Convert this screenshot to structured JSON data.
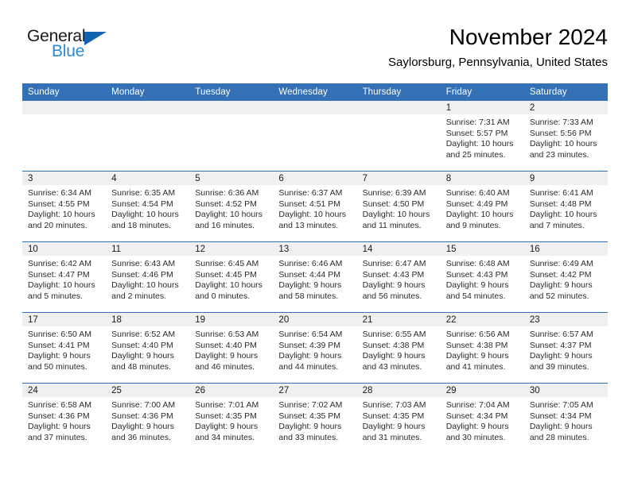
{
  "brand": {
    "name_dark": "General",
    "name_blue": "Blue",
    "triangle_color": "#1163ad",
    "blue_color": "#2a8ad4"
  },
  "header": {
    "title": "November 2024",
    "location": "Saylorsburg, Pennsylvania, United States"
  },
  "theme": {
    "header_blue": "#3370b5",
    "daynum_band": "#f0f0f0",
    "page_background": "#ffffff"
  },
  "weekdays": [
    "Sunday",
    "Monday",
    "Tuesday",
    "Wednesday",
    "Thursday",
    "Friday",
    "Saturday"
  ],
  "weeks": [
    [
      {
        "day": "",
        "empty": true
      },
      {
        "day": "",
        "empty": true
      },
      {
        "day": "",
        "empty": true
      },
      {
        "day": "",
        "empty": true
      },
      {
        "day": "",
        "empty": true
      },
      {
        "day": "1",
        "sunrise": "Sunrise: 7:31 AM",
        "sunset": "Sunset: 5:57 PM",
        "daylight": "Daylight: 10 hours and 25 minutes."
      },
      {
        "day": "2",
        "sunrise": "Sunrise: 7:33 AM",
        "sunset": "Sunset: 5:56 PM",
        "daylight": "Daylight: 10 hours and 23 minutes."
      }
    ],
    [
      {
        "day": "3",
        "sunrise": "Sunrise: 6:34 AM",
        "sunset": "Sunset: 4:55 PM",
        "daylight": "Daylight: 10 hours and 20 minutes."
      },
      {
        "day": "4",
        "sunrise": "Sunrise: 6:35 AM",
        "sunset": "Sunset: 4:54 PM",
        "daylight": "Daylight: 10 hours and 18 minutes."
      },
      {
        "day": "5",
        "sunrise": "Sunrise: 6:36 AM",
        "sunset": "Sunset: 4:52 PM",
        "daylight": "Daylight: 10 hours and 16 minutes."
      },
      {
        "day": "6",
        "sunrise": "Sunrise: 6:37 AM",
        "sunset": "Sunset: 4:51 PM",
        "daylight": "Daylight: 10 hours and 13 minutes."
      },
      {
        "day": "7",
        "sunrise": "Sunrise: 6:39 AM",
        "sunset": "Sunset: 4:50 PM",
        "daylight": "Daylight: 10 hours and 11 minutes."
      },
      {
        "day": "8",
        "sunrise": "Sunrise: 6:40 AM",
        "sunset": "Sunset: 4:49 PM",
        "daylight": "Daylight: 10 hours and 9 minutes."
      },
      {
        "day": "9",
        "sunrise": "Sunrise: 6:41 AM",
        "sunset": "Sunset: 4:48 PM",
        "daylight": "Daylight: 10 hours and 7 minutes."
      }
    ],
    [
      {
        "day": "10",
        "sunrise": "Sunrise: 6:42 AM",
        "sunset": "Sunset: 4:47 PM",
        "daylight": "Daylight: 10 hours and 5 minutes."
      },
      {
        "day": "11",
        "sunrise": "Sunrise: 6:43 AM",
        "sunset": "Sunset: 4:46 PM",
        "daylight": "Daylight: 10 hours and 2 minutes."
      },
      {
        "day": "12",
        "sunrise": "Sunrise: 6:45 AM",
        "sunset": "Sunset: 4:45 PM",
        "daylight": "Daylight: 10 hours and 0 minutes."
      },
      {
        "day": "13",
        "sunrise": "Sunrise: 6:46 AM",
        "sunset": "Sunset: 4:44 PM",
        "daylight": "Daylight: 9 hours and 58 minutes."
      },
      {
        "day": "14",
        "sunrise": "Sunrise: 6:47 AM",
        "sunset": "Sunset: 4:43 PM",
        "daylight": "Daylight: 9 hours and 56 minutes."
      },
      {
        "day": "15",
        "sunrise": "Sunrise: 6:48 AM",
        "sunset": "Sunset: 4:43 PM",
        "daylight": "Daylight: 9 hours and 54 minutes."
      },
      {
        "day": "16",
        "sunrise": "Sunrise: 6:49 AM",
        "sunset": "Sunset: 4:42 PM",
        "daylight": "Daylight: 9 hours and 52 minutes."
      }
    ],
    [
      {
        "day": "17",
        "sunrise": "Sunrise: 6:50 AM",
        "sunset": "Sunset: 4:41 PM",
        "daylight": "Daylight: 9 hours and 50 minutes."
      },
      {
        "day": "18",
        "sunrise": "Sunrise: 6:52 AM",
        "sunset": "Sunset: 4:40 PM",
        "daylight": "Daylight: 9 hours and 48 minutes."
      },
      {
        "day": "19",
        "sunrise": "Sunrise: 6:53 AM",
        "sunset": "Sunset: 4:40 PM",
        "daylight": "Daylight: 9 hours and 46 minutes."
      },
      {
        "day": "20",
        "sunrise": "Sunrise: 6:54 AM",
        "sunset": "Sunset: 4:39 PM",
        "daylight": "Daylight: 9 hours and 44 minutes."
      },
      {
        "day": "21",
        "sunrise": "Sunrise: 6:55 AM",
        "sunset": "Sunset: 4:38 PM",
        "daylight": "Daylight: 9 hours and 43 minutes."
      },
      {
        "day": "22",
        "sunrise": "Sunrise: 6:56 AM",
        "sunset": "Sunset: 4:38 PM",
        "daylight": "Daylight: 9 hours and 41 minutes."
      },
      {
        "day": "23",
        "sunrise": "Sunrise: 6:57 AM",
        "sunset": "Sunset: 4:37 PM",
        "daylight": "Daylight: 9 hours and 39 minutes."
      }
    ],
    [
      {
        "day": "24",
        "sunrise": "Sunrise: 6:58 AM",
        "sunset": "Sunset: 4:36 PM",
        "daylight": "Daylight: 9 hours and 37 minutes."
      },
      {
        "day": "25",
        "sunrise": "Sunrise: 7:00 AM",
        "sunset": "Sunset: 4:36 PM",
        "daylight": "Daylight: 9 hours and 36 minutes."
      },
      {
        "day": "26",
        "sunrise": "Sunrise: 7:01 AM",
        "sunset": "Sunset: 4:35 PM",
        "daylight": "Daylight: 9 hours and 34 minutes."
      },
      {
        "day": "27",
        "sunrise": "Sunrise: 7:02 AM",
        "sunset": "Sunset: 4:35 PM",
        "daylight": "Daylight: 9 hours and 33 minutes."
      },
      {
        "day": "28",
        "sunrise": "Sunrise: 7:03 AM",
        "sunset": "Sunset: 4:35 PM",
        "daylight": "Daylight: 9 hours and 31 minutes."
      },
      {
        "day": "29",
        "sunrise": "Sunrise: 7:04 AM",
        "sunset": "Sunset: 4:34 PM",
        "daylight": "Daylight: 9 hours and 30 minutes."
      },
      {
        "day": "30",
        "sunrise": "Sunrise: 7:05 AM",
        "sunset": "Sunset: 4:34 PM",
        "daylight": "Daylight: 9 hours and 28 minutes."
      }
    ]
  ]
}
